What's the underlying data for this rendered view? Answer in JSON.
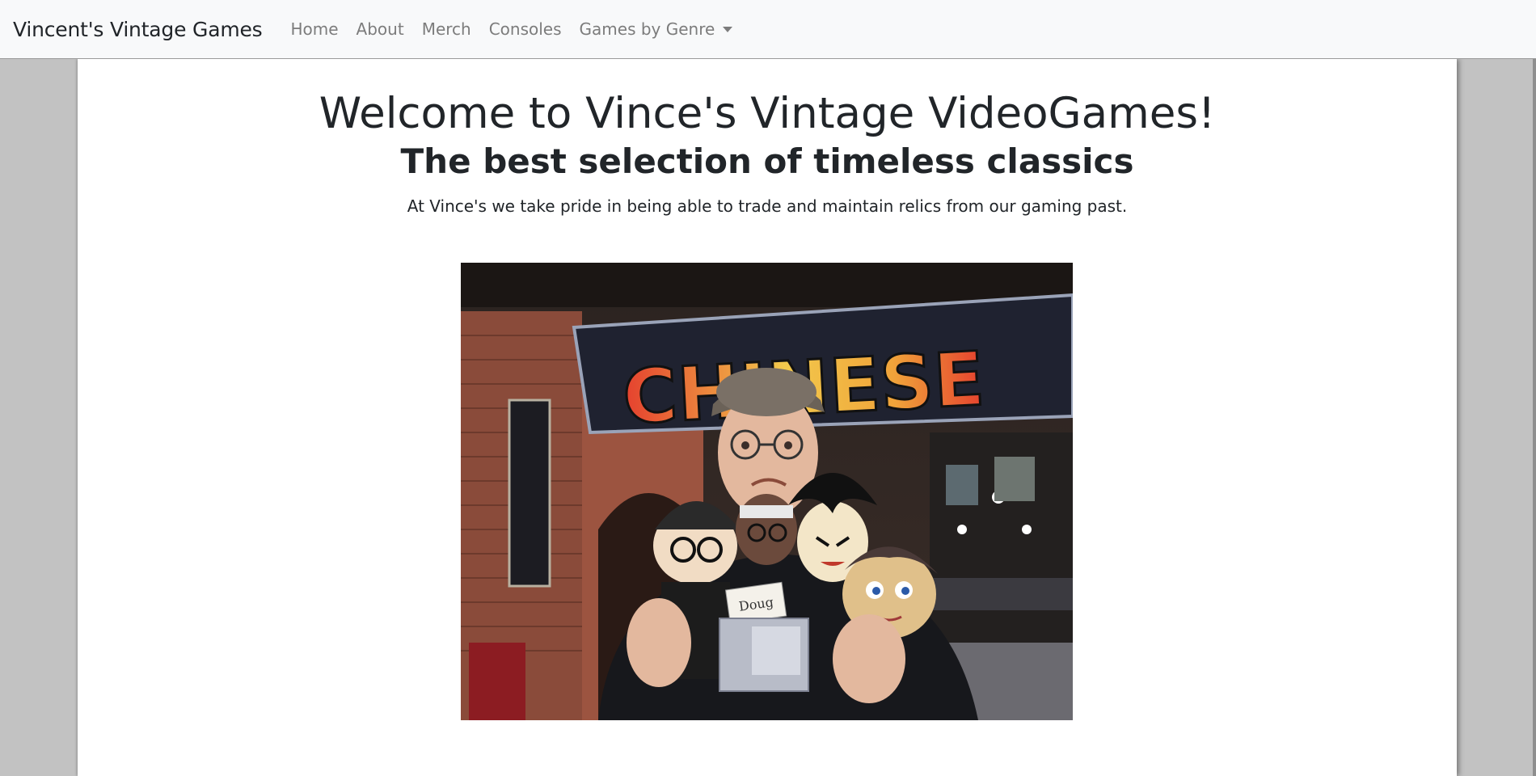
{
  "navbar": {
    "brand": "Vincent's Vintage Games",
    "links": [
      {
        "label": "Home"
      },
      {
        "label": "About"
      },
      {
        "label": "Merch"
      },
      {
        "label": "Consoles"
      },
      {
        "label": "Games by Genre"
      }
    ]
  },
  "hero": {
    "title": "Welcome to Vince's Vintage VideoGames!",
    "subtitle": "The best selection of timeless classics",
    "lead": "At Vince's we take pride in being able to trade and maintain relics from our gaming past."
  },
  "photo": {
    "sign_text": "CHINESE",
    "name_tag": "Doug"
  },
  "icons": {
    "dropdown": "caret-down-icon"
  }
}
